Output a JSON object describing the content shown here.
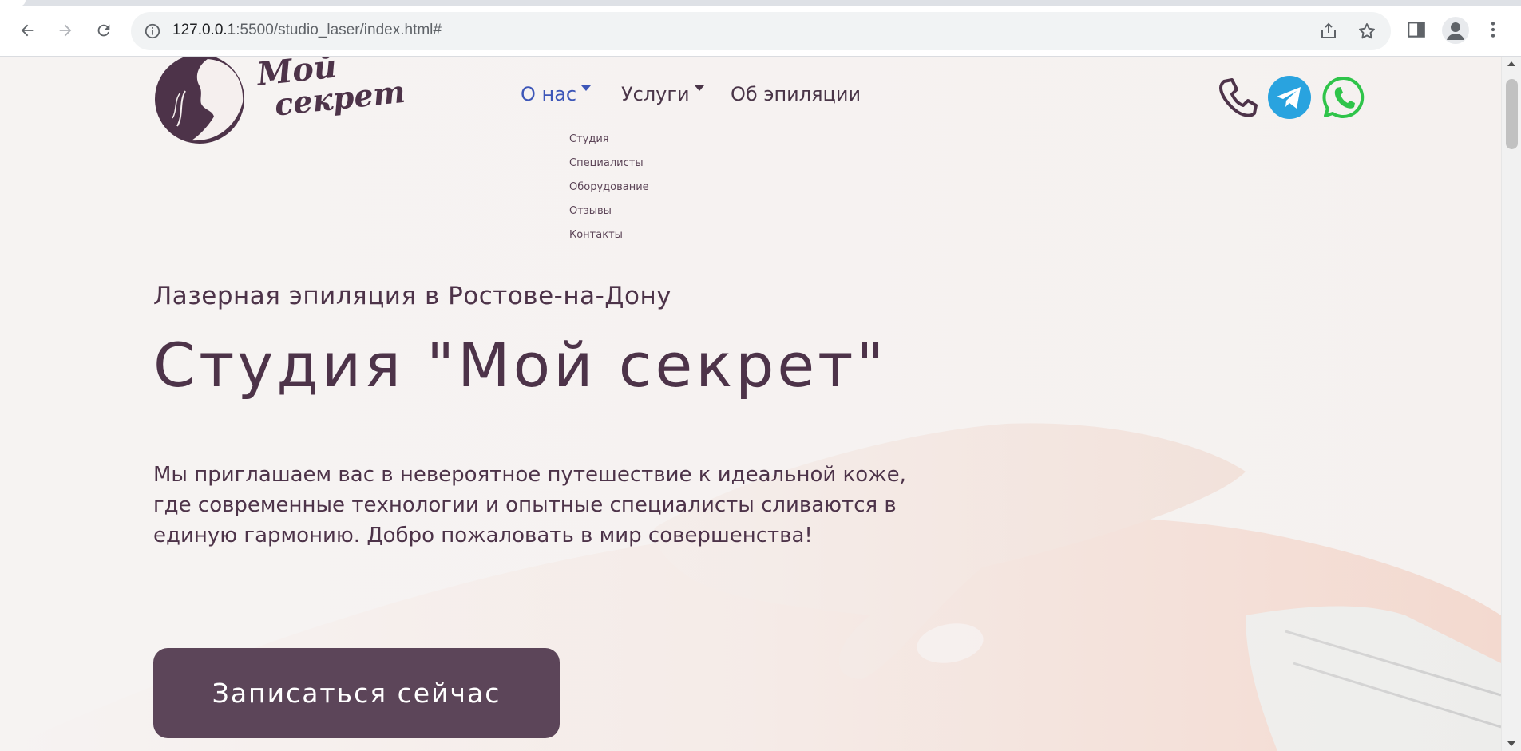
{
  "browser": {
    "url_host": "127.0.0.1",
    "url_rest": ":5500/studio_laser/index.html#",
    "back_icon": "arrow-left-icon",
    "forward_icon": "arrow-right-icon",
    "reload_icon": "reload-icon",
    "site_info_icon": "info-icon",
    "share_icon": "share-icon",
    "bookmark_icon": "star-icon",
    "side_panel_icon": "side-panel-icon",
    "profile_icon": "person-icon",
    "menu_icon": "kebab-menu-icon"
  },
  "logo": {
    "line1": "Мой",
    "line2": "секрет"
  },
  "nav": {
    "items": [
      {
        "label": "О нас",
        "has_dropdown": true,
        "active": true
      },
      {
        "label": "Услуги",
        "has_dropdown": true,
        "active": false
      },
      {
        "label": "Об эпиляции",
        "has_dropdown": false,
        "active": false
      }
    ],
    "dropdown": [
      "Студия",
      "Специалисты",
      "Оборудование",
      "Отзывы",
      "Контакты"
    ]
  },
  "contacts": {
    "phone_icon": "phone-icon",
    "telegram_icon": "telegram-icon",
    "whatsapp_icon": "whatsapp-icon"
  },
  "hero": {
    "subtitle": "Лазерная эпиляция в Ростове-на-Дону",
    "title": "Студия \"Мой секрет\"",
    "description": "Мы приглашаем вас в невероятное путешествие к идеальной коже, где современные технологии и опытные специалисты сливаются в единую гармонию. Добро пожаловать в мир совершенства!",
    "cta_label": "Записаться сейчас"
  },
  "colors": {
    "brand": "#4d3349",
    "button": "#5c4559",
    "nav_active": "#3d56b8",
    "telegram": "#29a3df",
    "whatsapp": "#2fc44a"
  }
}
